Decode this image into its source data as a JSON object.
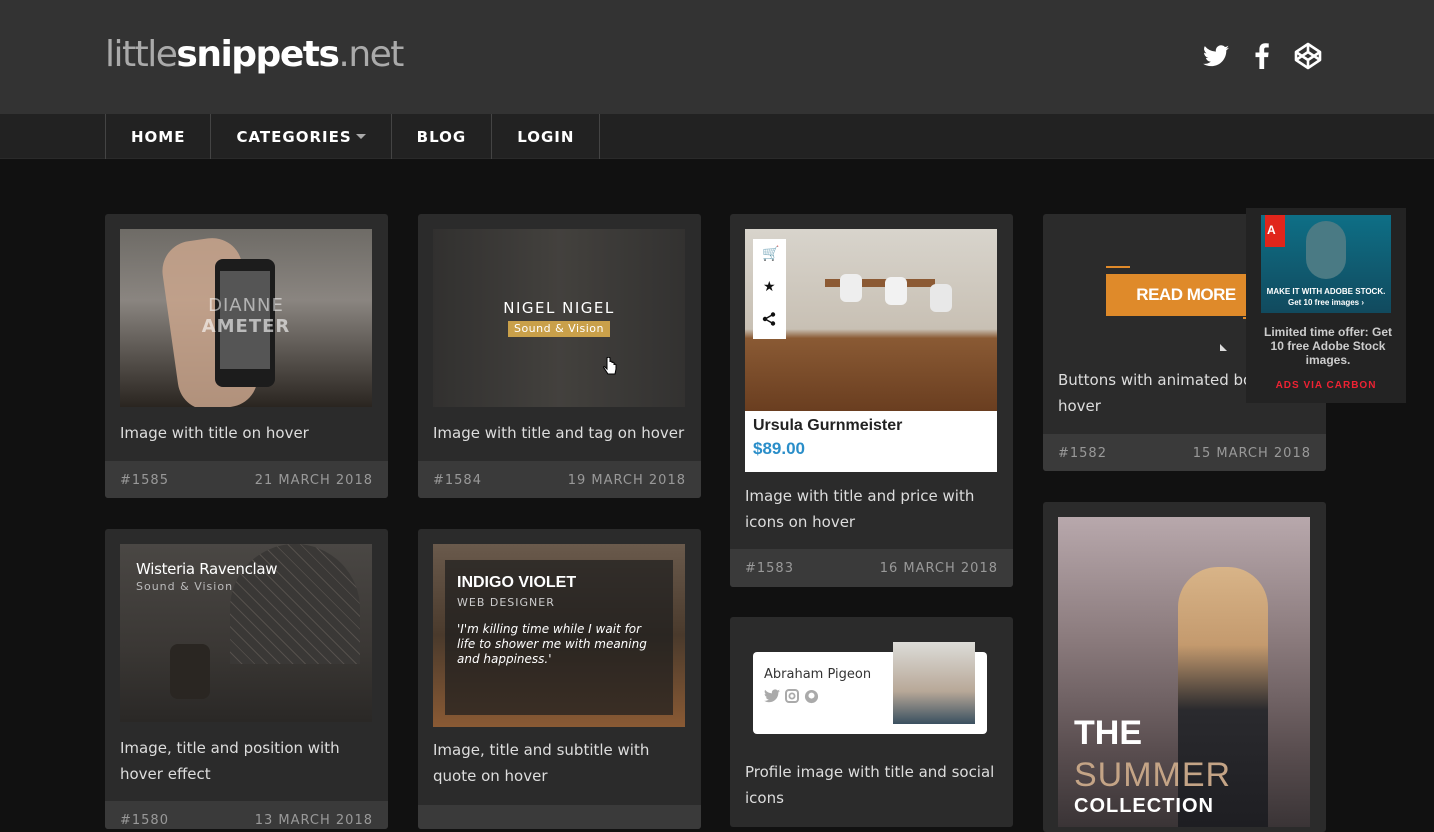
{
  "logo": {
    "part1": "little",
    "part2": "snippets",
    "part3": ".net"
  },
  "social": [
    "twitter-icon",
    "facebook-icon",
    "codepen-icon"
  ],
  "nav": [
    "HOME",
    "CATEGORIES",
    "BLOG",
    "LOGIN"
  ],
  "cards": [
    {
      "desc": "Image with title on hover",
      "id": "#1585",
      "date": "21 MARCH 2018",
      "overlay": {
        "line1": "DIANNE",
        "line2": "AMETER"
      }
    },
    {
      "desc": "Image with title and tag on hover",
      "id": "#1584",
      "date": "19 MARCH 2018",
      "overlay": {
        "title": "NIGEL NIGEL",
        "tag": "Sound & Vision"
      }
    },
    {
      "desc": "Image with title and price with icons on hover",
      "id": "#1583",
      "date": "16 MARCH 2018",
      "overlay": {
        "name": "Ursula Gurnmeister",
        "price": "$89.00"
      }
    },
    {
      "desc": "Buttons with animated border on hover",
      "id": "#1582",
      "date": "15 MARCH 2018",
      "overlay": {
        "button": "READ MORE"
      }
    },
    {
      "desc": "Image, title and position with hover effect",
      "id": "#1580",
      "date": "13 MARCH 2018",
      "overlay": {
        "title": "Wisteria Ravenclaw",
        "sub": "Sound & Vision"
      }
    },
    {
      "desc": "Image, title and subtitle with quote on hover",
      "overlay": {
        "title": "INDIGO VIOLET",
        "sub": "WEB DESIGNER",
        "quote": "'I'm killing time while I wait for life to shower me with meaning and happiness.'"
      }
    },
    {
      "desc": "Profile image with title and social icons",
      "overlay": {
        "name": "Abraham Pigeon"
      }
    },
    {
      "overlay": {
        "line1": "THE",
        "line2": "SUMMER",
        "line3": "COLLECTION"
      }
    }
  ],
  "ad": {
    "banner_line1": "MAKE IT WITH ADOBE STOCK.",
    "banner_line2": "Get 10 free images ›",
    "brand": "Adobe",
    "text": "Limited time offer: Get 10 free Adobe Stock images.",
    "via": "ADS VIA CARBON"
  }
}
